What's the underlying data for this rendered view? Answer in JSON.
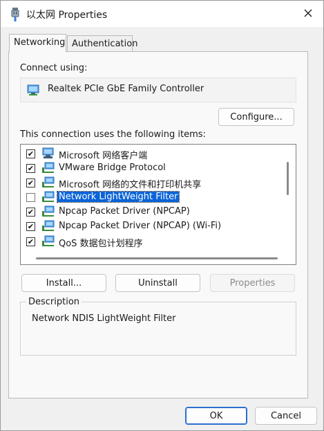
{
  "window": {
    "title": "以太网 Properties"
  },
  "tabs": [
    {
      "label": "Networking",
      "active": true
    },
    {
      "label": "Authentication",
      "active": false
    }
  ],
  "networking": {
    "connect_using_label": "Connect using:",
    "adapter_name": "Realtek PCIe GbE Family Controller",
    "configure_label": "Configure...",
    "items_label": "This connection uses the following items:",
    "items": [
      {
        "label": "Microsoft 网络客户端",
        "checked": true,
        "icon": "network-client-icon"
      },
      {
        "label": "VMware Bridge Protocol",
        "checked": true,
        "icon": "network-protocol-icon"
      },
      {
        "label": "Microsoft 网络的文件和打印机共享",
        "checked": true,
        "icon": "network-service-icon"
      },
      {
        "label": "Network LightWeight Filter",
        "checked": false,
        "selected": true,
        "icon": "network-filter-icon"
      },
      {
        "label": "Npcap Packet Driver (NPCAP)",
        "checked": true,
        "icon": "network-filter-icon"
      },
      {
        "label": "Npcap Packet Driver (NPCAP) (Wi-Fi)",
        "checked": true,
        "icon": "network-filter-icon"
      },
      {
        "label": "QoS 数据包计划程序",
        "checked": true,
        "icon": "network-filter-icon"
      }
    ],
    "install_label": "Install...",
    "uninstall_label": "Uninstall",
    "properties_label": "Properties",
    "description_title": "Description",
    "description_text": "Network NDIS LightWeight Filter"
  },
  "footer": {
    "ok_label": "OK",
    "cancel_label": "Cancel"
  },
  "colors": {
    "accent": "#0a64d8",
    "primary_border": "#2a6fd0"
  }
}
